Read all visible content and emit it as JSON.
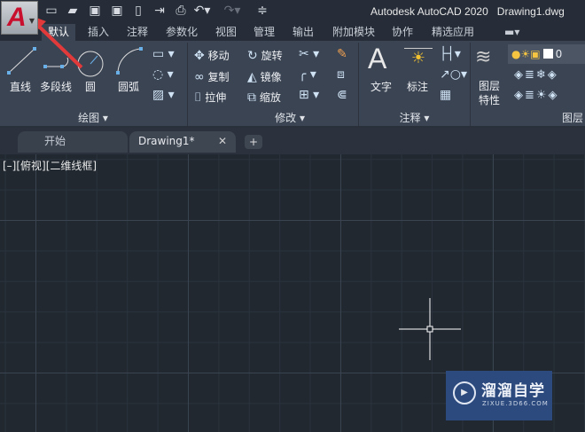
{
  "app": {
    "logo_letter": "A",
    "title": "Autodesk AutoCAD 2020",
    "filename": "Drawing1.dwg"
  },
  "quick_access": [
    "new-icon",
    "open-icon",
    "save-icon",
    "save-as-icon",
    "open-web-icon",
    "share-icon",
    "plot-icon",
    "undo-icon",
    "redo-icon",
    "customize-icon"
  ],
  "ribbon_tabs": [
    "默认",
    "插入",
    "注释",
    "参数化",
    "视图",
    "管理",
    "输出",
    "附加模块",
    "协作",
    "精选应用"
  ],
  "draw_panel": {
    "title": "绘图",
    "tools": [
      "直线",
      "多段线",
      "圆",
      "圆弧"
    ]
  },
  "modify_panel": {
    "title": "修改",
    "tools": [
      "移动",
      "旋转",
      "复制",
      "镜像",
      "拉伸",
      "缩放"
    ]
  },
  "annotation_panel": {
    "title": "注释",
    "tools": [
      "文字",
      "标注"
    ]
  },
  "layers_panel": {
    "title": "图层",
    "tool": "图层\n特性",
    "layer_name": "0",
    "tool_line1": "图层",
    "tool_line2": "特性"
  },
  "doc_tabs": [
    "开始",
    "Drawing1*"
  ],
  "viewport_label": "[–][俯视][二维线框]",
  "watermark": {
    "name": "溜溜自学",
    "url": "ZIXUE.3D66.COM"
  },
  "colors": {
    "accent": "#c8102e",
    "canvas": "#212830",
    "ribbon": "#3b4453"
  }
}
